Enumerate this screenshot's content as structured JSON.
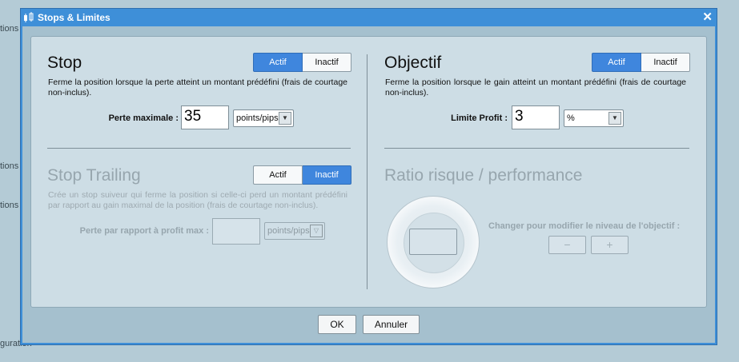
{
  "background": {
    "fragments": [
      "tions",
      "tions",
      "tions",
      "guration"
    ]
  },
  "window": {
    "title": "Stops & Limites",
    "close_glyph": "✕"
  },
  "stop": {
    "heading": "Stop",
    "toggle": {
      "active_label": "Actif",
      "inactive_label": "Inactif",
      "selected": "Actif"
    },
    "description": "Ferme la position lorsque la perte atteint un montant prédéfini (frais de courtage non-inclus).",
    "field_label": "Perte maximale :",
    "value": "35",
    "unit": "points/pips"
  },
  "trailing": {
    "heading": "Stop Trailing",
    "toggle": {
      "active_label": "Actif",
      "inactive_label": "Inactif",
      "selected": "Inactif"
    },
    "description": "Crée un stop suiveur qui ferme la position si celle-ci perd un montant prédéfini par rapport au gain maximal de la position (frais de courtage non-inclus).",
    "field_label": "Perte par rapport à profit max :",
    "value": "",
    "unit": "points/pips"
  },
  "objective": {
    "heading": "Objectif",
    "toggle": {
      "active_label": "Actif",
      "inactive_label": "Inactif",
      "selected": "Actif"
    },
    "description": "Ferme la position lorsque le gain atteint un montant prédéfini (frais de courtage non-inclus).",
    "field_label": "Limite Profit :",
    "value": "3",
    "unit": "%"
  },
  "ratio": {
    "heading": "Ratio risque / performance",
    "hint": "Changer pour modifier le niveau de l'objectif :",
    "minus_glyph": "−",
    "plus_glyph": "+"
  },
  "buttons": {
    "ok": "OK",
    "cancel": "Annuler"
  },
  "colors": {
    "accent": "#3f86dd",
    "window_frame": "#3e8fd8",
    "panel": "#cddde5"
  }
}
